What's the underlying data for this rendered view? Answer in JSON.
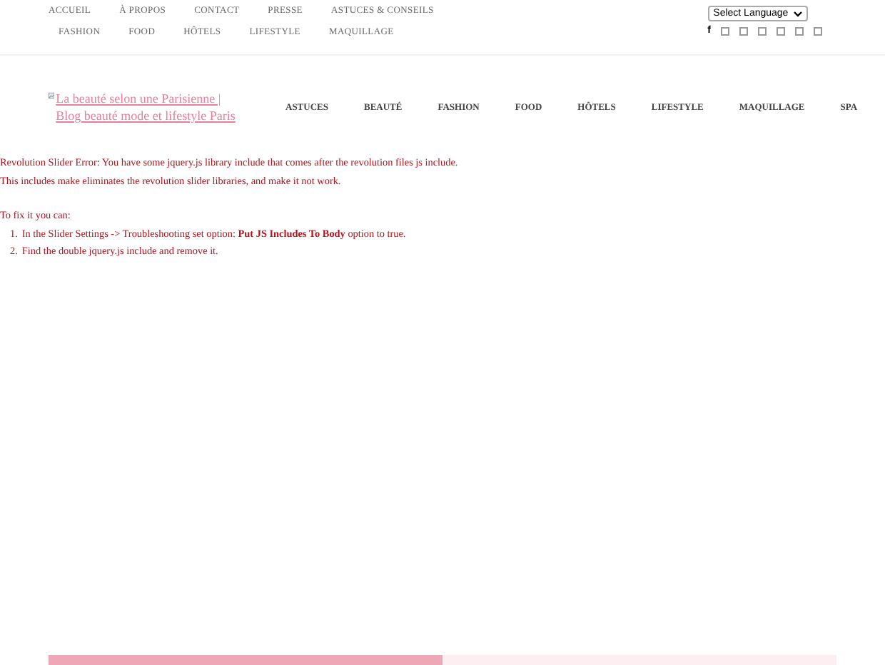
{
  "top_menu": {
    "row_1": [
      "ACCUEIL",
      "À PROPOS",
      "CONTACT",
      "PRESSE",
      "ASTUCES & CONSEILS"
    ],
    "row_2": [
      "FASHION",
      "FOOD",
      "HÔTELS",
      "LIFESTYLE",
      "MAQUILLAGE"
    ]
  },
  "language_select": {
    "value": "Select Language"
  },
  "social_icons": {
    "first": "f"
  },
  "logo": {
    "alt_text": "La beauté selon une Parisienne | Blog beauté mode et lifestyle Paris"
  },
  "main_menu": [
    "ASTUCES",
    "BEAUTÉ",
    "FASHION",
    "FOOD",
    "HÔTELS",
    "LIFESTYLE",
    "MAQUILLAGE",
    "SPA"
  ],
  "error": {
    "lines": [
      "Revolution Slider Error: You have some jquery.js library include that comes after the revolution files js include.",
      "This includes make eliminates the revolution slider libraries, and make it not work."
    ],
    "fix_intro": "To fix it you can:",
    "steps": [
      {
        "marker": "1.",
        "text": "In the Slider Settings -> Troubleshooting set option: **Put JS Includes To Body** option to true."
      },
      {
        "marker": "2.",
        "text": "Find the double jquery.js include and remove it."
      }
    ]
  },
  "slider_progress": {
    "level": 0.5
  }
}
